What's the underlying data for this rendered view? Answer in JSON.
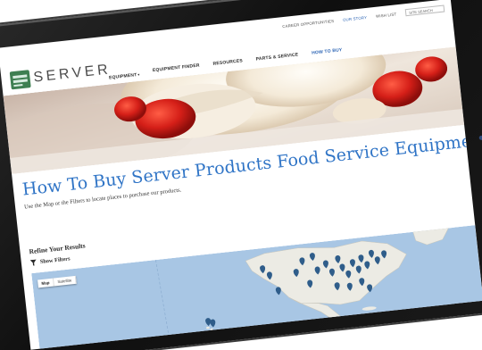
{
  "header": {
    "utility_links": [
      {
        "label": "CAREER OPPORTUNITIES",
        "active": false
      },
      {
        "label": "OUR STORY",
        "active": true
      },
      {
        "label": "WISH LIST",
        "active": false
      }
    ],
    "search_placeholder": "SITE SEARCH"
  },
  "logo": {
    "text": "SERVER"
  },
  "nav": [
    {
      "label": "EQUIPMENT",
      "has_dropdown": true,
      "active": false
    },
    {
      "label": "EQUIPMENT FINDER",
      "has_dropdown": false,
      "active": false
    },
    {
      "label": "RESOURCES",
      "has_dropdown": false,
      "active": false
    },
    {
      "label": "PARTS & SERVICE",
      "has_dropdown": false,
      "active": false
    },
    {
      "label": "HOW TO BUY",
      "has_dropdown": false,
      "active": true
    }
  ],
  "page": {
    "title": "How To Buy Server Products Food Service Equipment",
    "subtitle": "Use the Map or the Filters to locate places to purchase our products."
  },
  "refine": {
    "title": "Refine Your Results",
    "filter_label": "Show Filters"
  },
  "map": {
    "toggle": [
      "Map",
      "Satellite"
    ],
    "selected": "Map",
    "marker_color": "#2f5d8a",
    "water_color": "#a8c6e4",
    "land_color": "#ecebe4"
  },
  "colors": {
    "accent_blue": "#2f74c6",
    "brand_green": "#3e7f51",
    "device_black": "#141414"
  },
  "icons": {
    "filter": "funnel-icon",
    "dropdown": "caret-down-icon",
    "marker": "map-pin-icon"
  }
}
